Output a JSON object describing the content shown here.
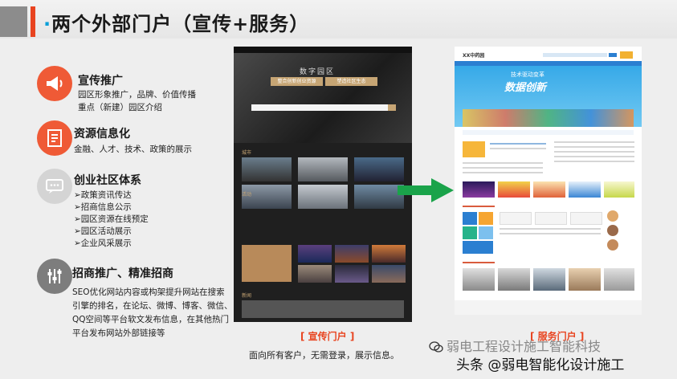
{
  "title": {
    "prefix": "·",
    "text": "两个外部门户（宣传+服务）"
  },
  "features": [
    {
      "title": "宣传推广",
      "lines": [
        "园区形象推广，品牌、价值传播",
        "重点（新建）园区介绍"
      ],
      "icon": "megaphone-icon"
    },
    {
      "title": "资源信息化",
      "lines": [
        "金融、人才、技术、政策的展示"
      ],
      "icon": "document-icon"
    },
    {
      "title": "创业社区体系",
      "lines": [
        "➢政策资讯传达",
        "➢招商信息公示",
        "➢园区资源在线预定",
        "➢园区活动展示",
        "➢企业风采展示"
      ],
      "icon": "chat-icon"
    },
    {
      "title": "招商推广、精准招商",
      "lines": [
        "SEO优化网站内容或构架提升网站在搜索引擎的排名，在论坛、微博、博客、微信、QQ空间等平台软文发布信息，在其他热门平台发布网站外部链接等"
      ],
      "icon": "sliders-icon"
    }
  ],
  "left_portal": {
    "hero_title": "数字园区",
    "search_tabs": [
      "整合创新创业资源",
      "塑造社区生态"
    ],
    "sections": [
      "城市",
      "活动",
      "新闻"
    ],
    "caption": "[ 宣传门户 ]",
    "subcaption": "面向所有客户，无需登录，展示信息。"
  },
  "right_portal": {
    "logo": "XX中药园",
    "hero_line1": "技术驱动变革",
    "hero_line2": "数据创新",
    "caption": "[ 服务门户 ]"
  },
  "arrow": {
    "color": "#1aa34a"
  },
  "watermarks": [
    "弱电工程设计施工智能科技",
    "头条 @弱电智能化设计施工"
  ],
  "colors": {
    "accent": "#e8431f",
    "title_dot": "#0a9fd8"
  }
}
